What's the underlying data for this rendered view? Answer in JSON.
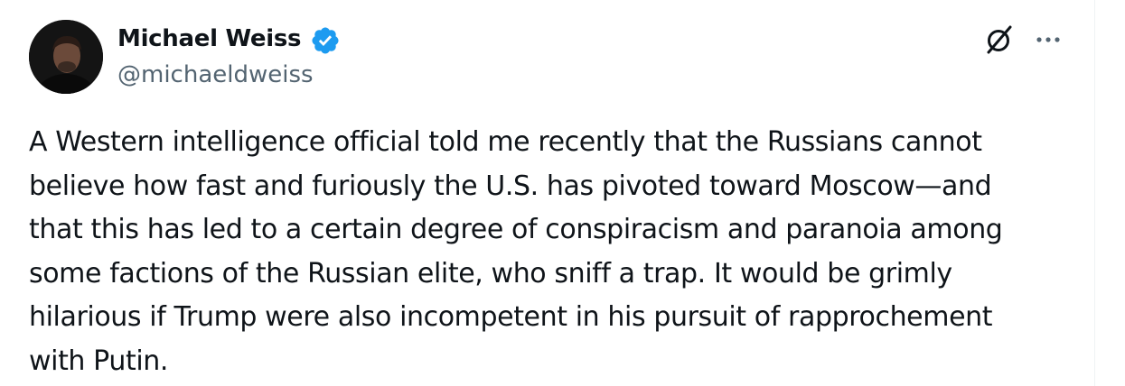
{
  "tweet": {
    "author": {
      "name": "Michael Weiss",
      "handle": "@michaeldweiss",
      "verified": true,
      "verified_color": "#1d9bf0"
    },
    "icons": {
      "grok": "grok-icon",
      "more": "more-icon",
      "verified": "verified-badge-icon"
    },
    "text_lines": [
      "A Western intelligence official told me recently that the Russians cannot",
      "believe how fast and furiously the U.S. has pivoted toward Moscow—and",
      "that this has led to a certain degree of conspiracism and paranoia among",
      "some factions of the Russian elite, who sniff a trap. It would be grimly",
      "hilarious if Trump were also incompetent in his pursuit of rapprochement",
      "with Putin."
    ]
  }
}
